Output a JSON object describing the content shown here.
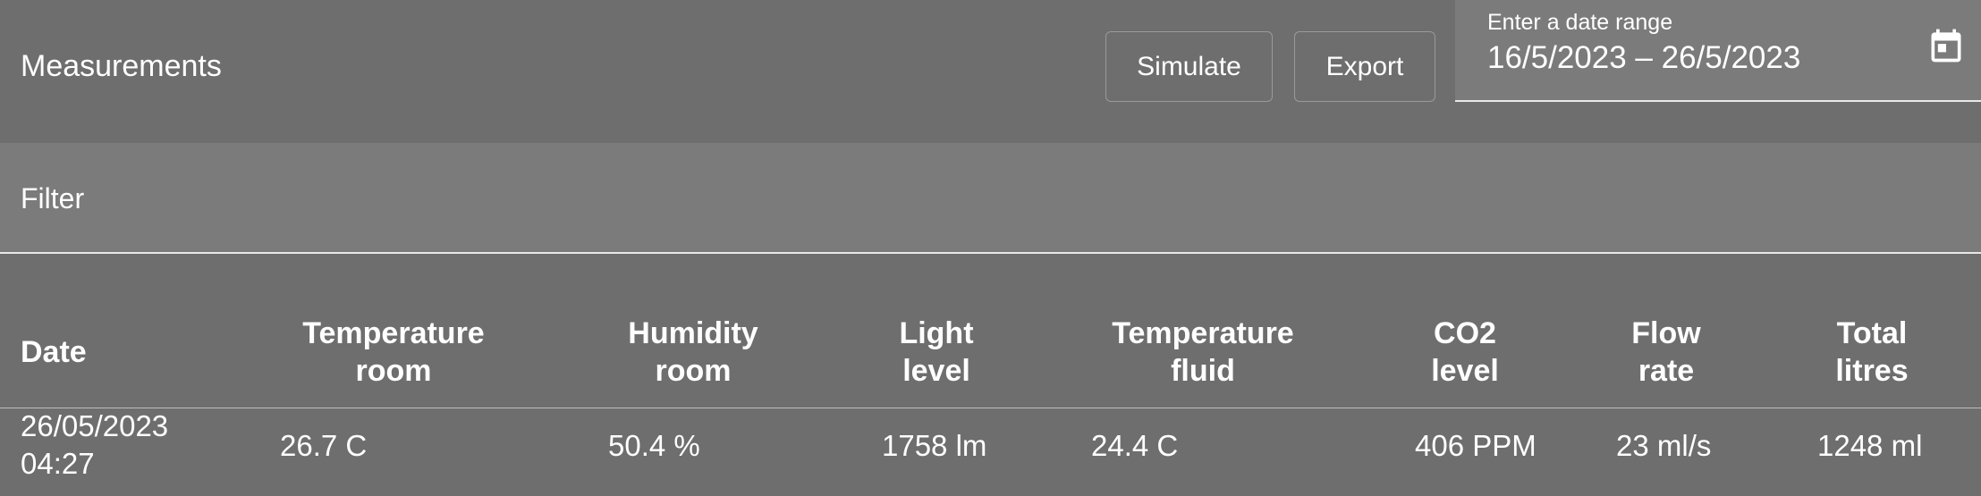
{
  "header": {
    "title": "Measurements",
    "simulate_label": "Simulate",
    "export_label": "Export",
    "date_range": {
      "label": "Enter a date range",
      "value": "16/5/2023 – 26/5/2023",
      "icon": "calendar-icon"
    }
  },
  "filter": {
    "label": "Filter"
  },
  "table": {
    "columns": [
      {
        "line1": "Date",
        "line2": ""
      },
      {
        "line1": "Temperature",
        "line2": "room"
      },
      {
        "line1": "Humidity",
        "line2": "room"
      },
      {
        "line1": "Light",
        "line2": "level"
      },
      {
        "line1": "Temperature",
        "line2": "fluid"
      },
      {
        "line1": "CO2",
        "line2": "level"
      },
      {
        "line1": "Flow",
        "line2": "rate"
      },
      {
        "line1": "Total",
        "line2": "litres"
      }
    ],
    "rows": [
      {
        "date_line1": "26/05/2023",
        "date_line2": "04:27",
        "temperature_room": "26.7 C",
        "humidity_room": "50.4 %",
        "light_level": "1758 lm",
        "temperature_fluid": "24.4 C",
        "co2_level": "406 PPM",
        "flow_rate": "23 ml/s",
        "total_litres": "1248 ml"
      }
    ]
  }
}
